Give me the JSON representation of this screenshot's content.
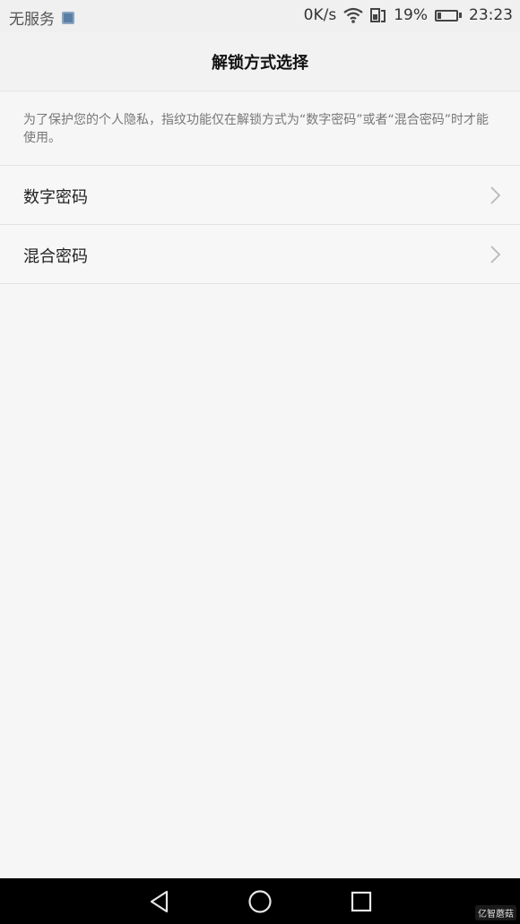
{
  "status_bar": {
    "carrier": "无服务",
    "net_speed": "0K/s",
    "battery_pct": "19%",
    "time": "23:23",
    "icons": [
      "sim-icon",
      "wifi-icon",
      "data-icon",
      "battery-icon"
    ]
  },
  "header": {
    "title": "解锁方式选择"
  },
  "info": {
    "text": "为了保护您的个人隐私，指纹功能仅在解锁方式为“数字密码”或者“混合密码”时才能使用。"
  },
  "options": [
    {
      "label": "数字密码"
    },
    {
      "label": "混合密码"
    }
  ],
  "nav_bar": {
    "buttons": [
      "back-icon",
      "home-icon",
      "recents-icon"
    ]
  },
  "watermark": "亿智蘑菇"
}
